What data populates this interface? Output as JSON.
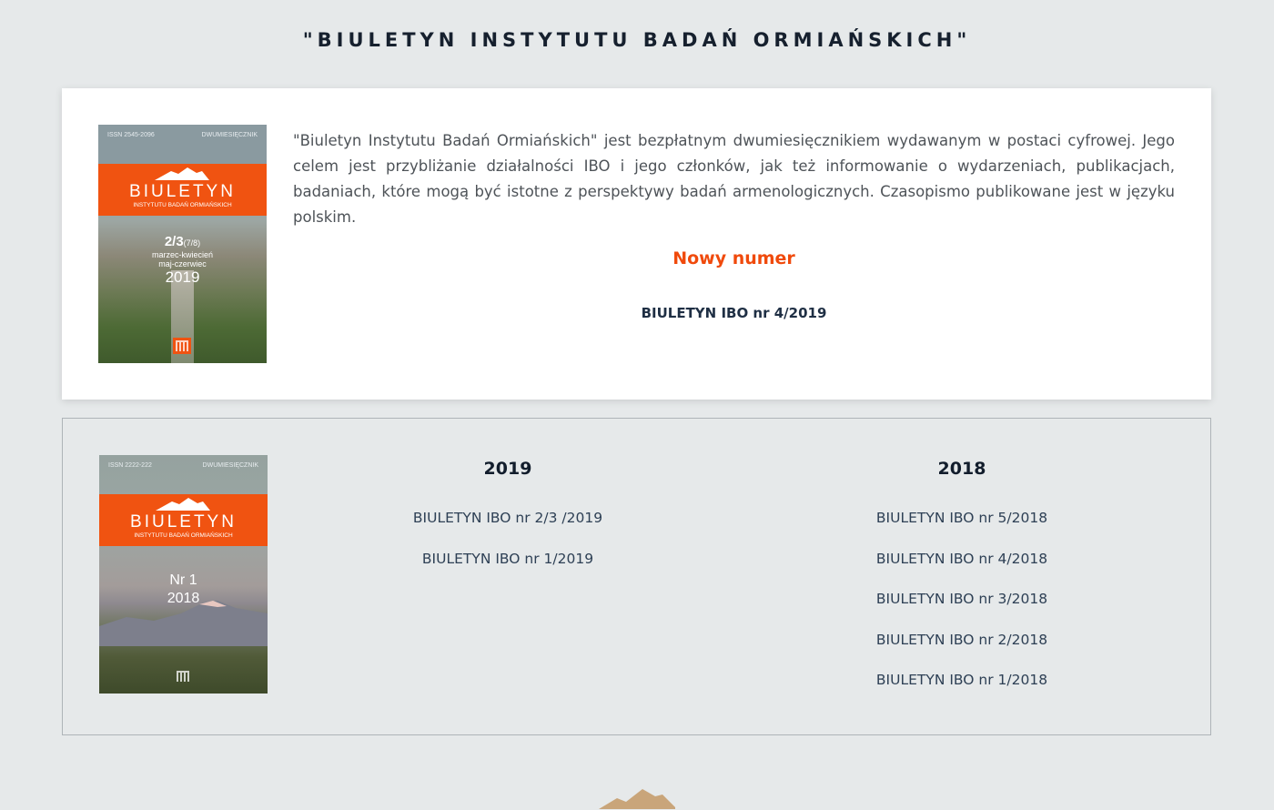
{
  "page": {
    "title": "\"BIULETYN INSTYTUTU BADAŃ ORMIAŃSKICH\""
  },
  "intro": {
    "description": "\"Biuletyn Instytutu Badań Ormiańskich\" jest bezpłatnym dwumiesięcznikiem wydawanym w postaci cyfrowej. Jego celem jest przybliżanie działalności IBO i jego członków, jak też informowanie o wydarzeniach, publikacjach, badaniach, które mogą być istotne z perspektywy badań armenologicznych. Czasopismo publikowane jest w języku polskim.",
    "new_issue_label": "Nowy numer",
    "new_issue_link": "BIULETYN IBO nr 4/2019"
  },
  "covers": {
    "current": {
      "issn": "ISSN 2545-2096",
      "frequency": "DWUMIESIĘCZNIK",
      "title": "BIULETYN",
      "subtitle": "INSTYTUTU BADAŃ ORMIAŃSKICH",
      "number": "2/3",
      "number_suffix": "(7/8)",
      "months_line1": "marzec-kwiecień",
      "months_line2": "maj-czerwiec",
      "year": "2019",
      "logo": "IBO"
    },
    "archive": {
      "issn": "ISSN 2222-222",
      "frequency": "DWUMIESIĘCZNIK",
      "title": "BIULETYN",
      "subtitle": "INSTYTUTU BADAŃ ORMIAŃSKICH",
      "number": "Nr 1",
      "year": "2018",
      "logo": "IBO"
    }
  },
  "archive": {
    "y2019": {
      "year": "2019",
      "issues": [
        "BIULETYN IBO nr 2/3 /2019",
        "BIULETYN IBO nr 1/2019"
      ]
    },
    "y2018": {
      "year": "2018",
      "issues": [
        "BIULETYN IBO nr 5/2018",
        "BIULETYN IBO nr 4/2018",
        "BIULETYN IBO nr 3/2018",
        "BIULETYN IBO nr 2/2018",
        "BIULETYN IBO nr 1/2018"
      ]
    }
  },
  "colors": {
    "accent": "#f04a0c",
    "background": "#e6e9ea",
    "mountain": "#c9a57a"
  },
  "icons": {
    "footer": "mountain-icon",
    "logo": "ibo-logo-icon"
  }
}
